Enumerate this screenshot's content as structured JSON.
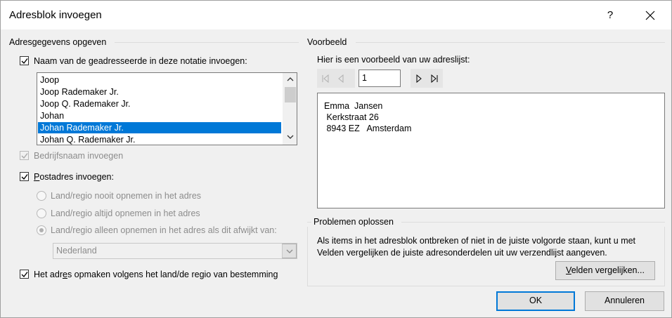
{
  "dialog": {
    "title": "Adresblok invoegen",
    "help": "?",
    "close": "close"
  },
  "left": {
    "group_label": "Adresgegevens opgeven",
    "recipient_name": {
      "pre": "Naam van de ",
      "key": "g",
      "post": "eadresseerde in deze notatie invoegen:",
      "checked": true
    },
    "name_formats": [
      "Joop",
      "Joop Rademaker Jr.",
      "Joop Q. Rademaker Jr.",
      "Johan",
      "Johan Rademaker Jr.",
      "Johan Q. Rademaker Jr."
    ],
    "selected_index": 4,
    "company_name": {
      "label": "Bedrijfsnaam invoegen",
      "checked": true,
      "disabled": true
    },
    "postal_address": {
      "key": "P",
      "rest": "ostadres invoegen:",
      "checked": true
    },
    "radios": [
      {
        "label": "Land/regio nooit opnemen in het adres",
        "selected": false
      },
      {
        "label": "Land/regio altijd opnemen in het adres",
        "selected": false
      },
      {
        "label": "Land/regio alleen opnemen in het adres als dit afwijkt van:",
        "selected": true
      }
    ],
    "country_select": "Nederland",
    "format_address": {
      "pre": "Het adr",
      "key": "e",
      "post": "s opmaken volgens het land/de regio van bestemming",
      "checked": true
    }
  },
  "right": {
    "group_label": "Voorbeeld",
    "preview_caption": "Hier is een voorbeeld van uw adreslijst:",
    "record_number": "1",
    "preview_lines": [
      "Emma  Jansen",
      " Kerkstraat 26",
      " 8943 EZ   Amsterdam"
    ],
    "problems_label": "Problemen oplossen",
    "problems_text": "Als items in het adresblok ontbreken of niet in de juiste volgorde staan, kunt u met Velden vergelijken de juiste adresonderdelen uit uw verzendlijst aangeven.",
    "match_fields": {
      "key": "V",
      "rest": "elden vergelijken..."
    }
  },
  "footer": {
    "ok": "OK",
    "cancel": "Annuleren"
  },
  "colors": {
    "accent": "#0078d7",
    "dialog_bg": "#f0f0f0",
    "disabled_text": "#8c8c8c"
  }
}
